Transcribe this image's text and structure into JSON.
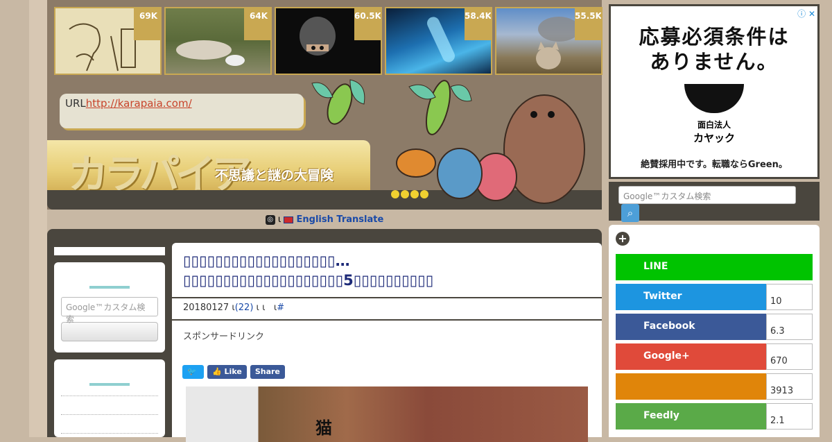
{
  "header": {
    "thumbnails": [
      {
        "count": "69K"
      },
      {
        "count": "64K"
      },
      {
        "count": "60.5K"
      },
      {
        "count": "58.4K"
      },
      {
        "count": "55.5K"
      }
    ],
    "url_label": "URL",
    "url_link": "http://karapaia.com/",
    "logo_text": "カラパイア",
    "logo_subtitle": "不思議と謎の大冒険"
  },
  "translate_bar": {
    "separator": "ι",
    "label": "English Translate"
  },
  "sidebar_left": {
    "search_placeholder": "Google™カスタム検索"
  },
  "article": {
    "title": "▯▯▯▯▯▯▯▯▯▯▯▯▯▯▯▯▯▯▯…▯▯▯▯▯▯▯▯▯▯▯▯▯▯▯▯▯▯▯▯5▯▯▯▯▯▯▯▯▯▯",
    "date": "20180127",
    "meta_sep1": "ι",
    "comments": "(22)",
    "meta_sep2": "ι ι",
    "meta_sep3": "ι",
    "hash": "#",
    "sponsor": "スポンサードリンク",
    "share_like": "Like",
    "share_share": "Share",
    "photo_caption": "猫"
  },
  "ad": {
    "badge": "ⓘ ✕",
    "title_line1": "応募必須条件は",
    "title_line2": "ありません。",
    "brand_line1": "面白法人",
    "brand_line2": "カヤック",
    "footer": "絶賛採用中です。転職ならGreen。"
  },
  "right_search": {
    "placeholder": "Google™カスタム検索"
  },
  "social": [
    {
      "name": "LINE",
      "count": "",
      "color": "#00c300"
    },
    {
      "name": "Twitter",
      "count": "10",
      "color": "#1d95e0"
    },
    {
      "name": "Facebook",
      "count": "6.3",
      "color": "#3b5998"
    },
    {
      "name": "Google+",
      "count": "670",
      "color": "#e04a3a"
    },
    {
      "name": "",
      "count": "3913",
      "color": "#e0850a"
    },
    {
      "name": "Feedly",
      "count": "2.1",
      "color": "#5aaa48"
    }
  ]
}
